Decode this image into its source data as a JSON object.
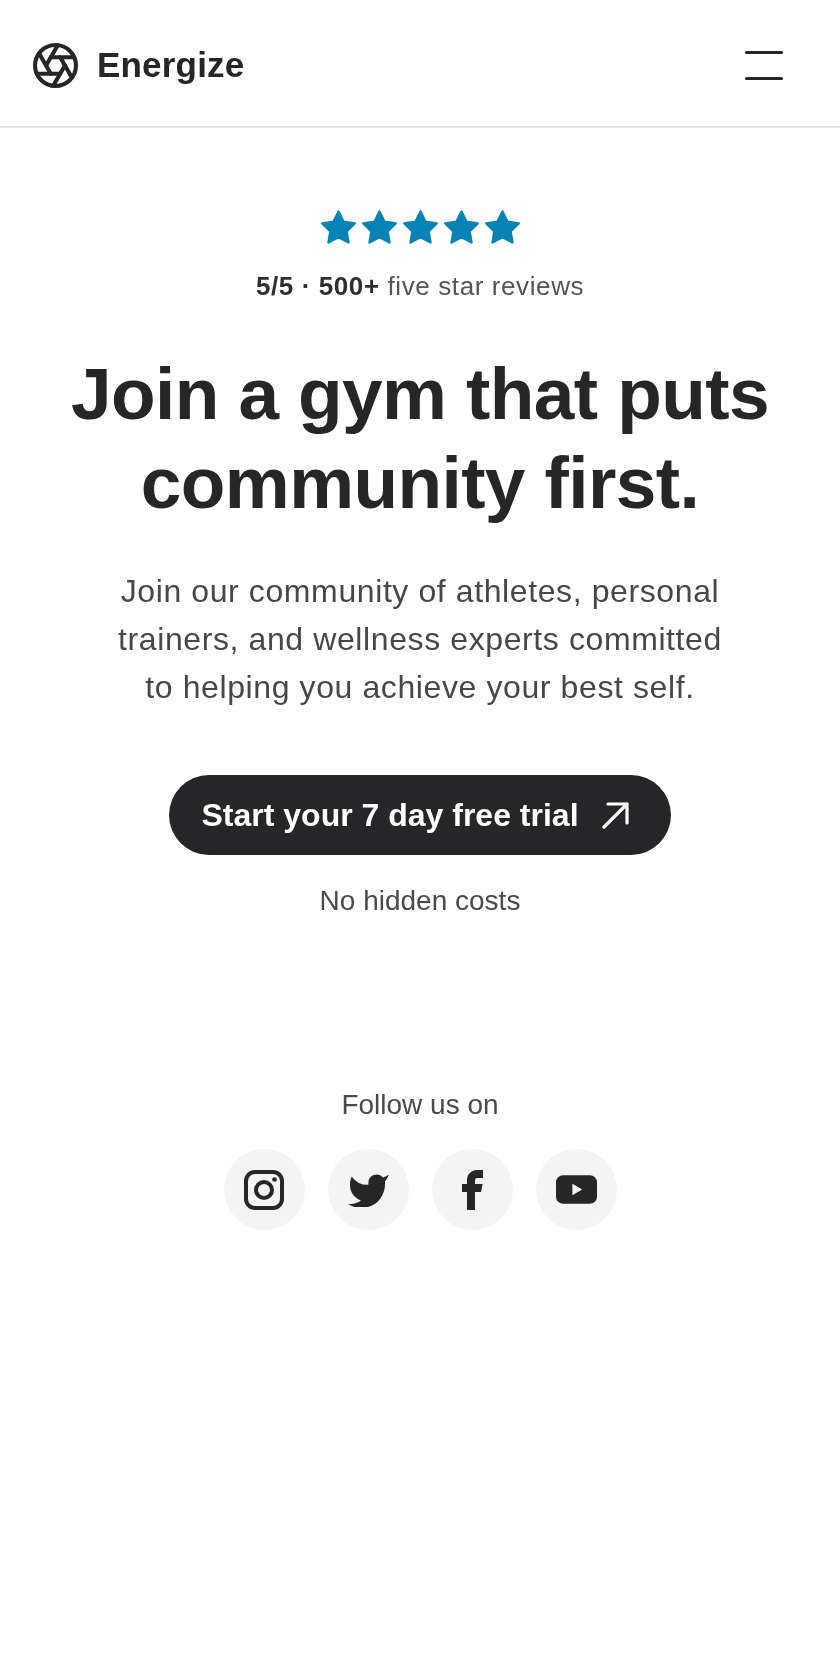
{
  "header": {
    "brand": "Energize"
  },
  "rating": {
    "stars": 5,
    "text": "**5/5 · 500+** five star reviews"
  },
  "hero": {
    "title": "Join a gym that puts community first.",
    "subtitle": "Join our community of athletes, personal trainers, and wellness experts committed to helping you achieve your best self."
  },
  "cta": {
    "label": "Start your 7 day free trial",
    "note": "No hidden costs"
  },
  "social": {
    "label": "Follow us on"
  }
}
